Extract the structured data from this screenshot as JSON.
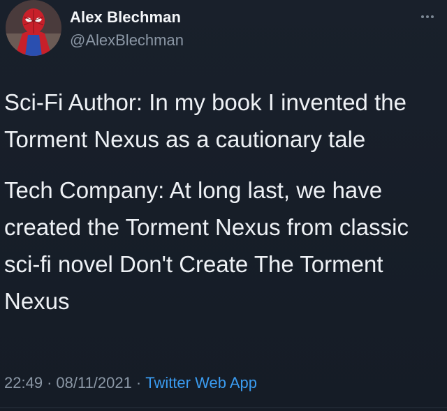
{
  "author": {
    "name": "Alex Blechman",
    "handle": "@AlexBlechman",
    "avatar": "spider-man-avatar-icon"
  },
  "more_icon": "more-dots-icon",
  "tweet": {
    "paragraphs": [
      "Sci-Fi Author: In my book I invented the Torment Nexus as a cautionary tale",
      "Tech Company: At long last, we have created the Torment Nexus from classic sci-fi novel Don't Create The Torment Nexus"
    ]
  },
  "meta": {
    "time": "22:49",
    "separator": "·",
    "date": "08/11/2021",
    "source": "Twitter Web App"
  },
  "colors": {
    "background": "#161d27",
    "text": "#eef1f5",
    "secondary": "#8b97a5",
    "link": "#3a9bf0"
  }
}
